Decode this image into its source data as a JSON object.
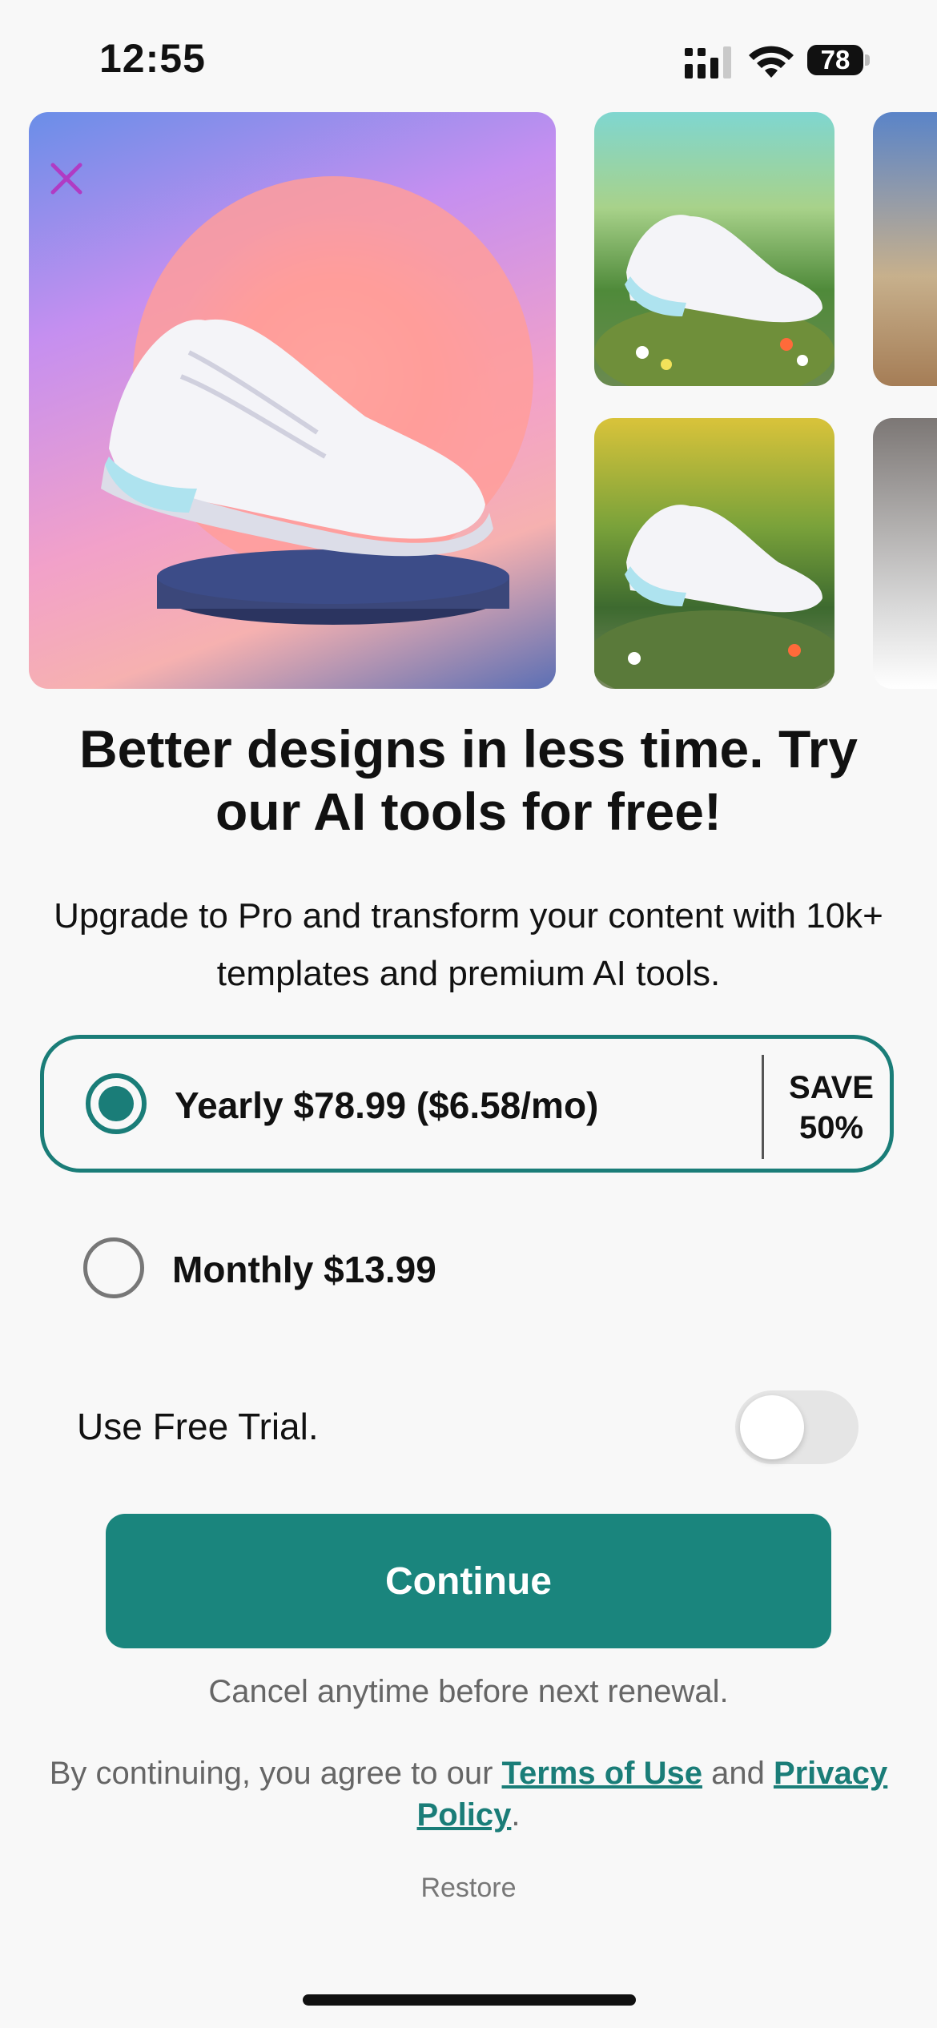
{
  "status_bar": {
    "time": "12:55",
    "battery": "78",
    "icons": [
      "cellular-signal-icon",
      "wifi-icon",
      "battery-icon"
    ]
  },
  "gallery": {
    "close_icon": "close-icon",
    "tiles": [
      "sneaker-sunset-podium",
      "sneaker-meadow-flowers",
      "sneaker-desert-dunes",
      "sneaker-yellow-meadow",
      "sneaker-grey-studio"
    ]
  },
  "headline": "Better designs in less time. Try our AI tools for free!",
  "subtext": "Upgrade to Pro and transform your content with 10k+ templates and premium AI tools.",
  "plans": {
    "yearly": {
      "label": "Yearly $78.99 ($6.58/mo)",
      "badge_line1": "SAVE",
      "badge_line2": "50%",
      "selected": true
    },
    "monthly": {
      "label": "Monthly $13.99",
      "selected": false
    }
  },
  "trial": {
    "label": "Use Free Trial.",
    "enabled": false
  },
  "continue_label": "Continue",
  "cancel_note": "Cancel anytime before next renewal.",
  "legal": {
    "prefix": "By continuing, you agree to our ",
    "terms": "Terms of Use",
    "and": " and ",
    "privacy": "Privacy Policy",
    "suffix": "."
  },
  "restore_label": "Restore",
  "colors": {
    "accent": "#1a857d",
    "close_icon": "#b03bc4"
  }
}
